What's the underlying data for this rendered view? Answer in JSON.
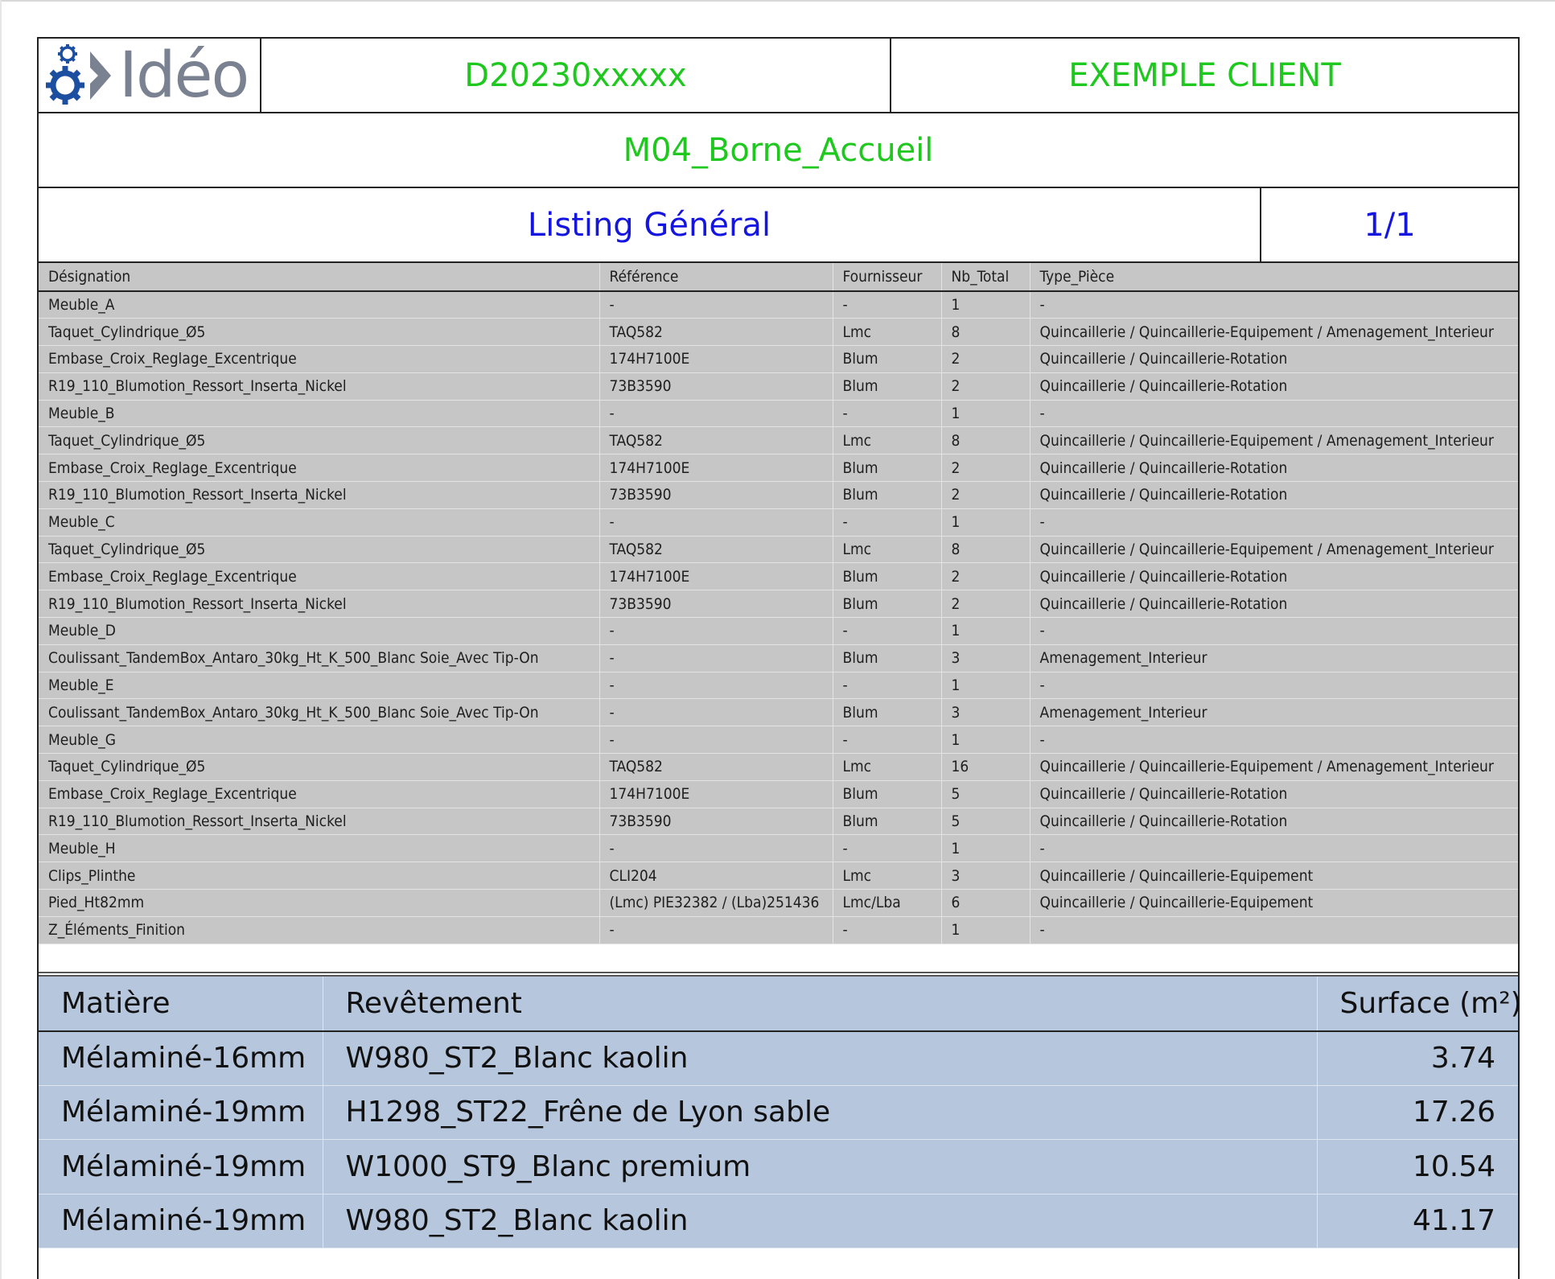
{
  "header": {
    "logo_text": "Idéo",
    "project_code": "D20230xxxxx",
    "client": "EXEMPLE CLIENT",
    "module": "M04_Borne_Accueil",
    "listing_title": "Listing Général",
    "page": "1/1"
  },
  "colors": {
    "green_text": "#1ec81e",
    "blue_text": "#1515e0",
    "table_gray": "#c6c6c6",
    "material_blue": "#b6c6dc",
    "logo_blue": "#1c4fa0"
  },
  "listing": {
    "columns": [
      "Désignation",
      "Référence",
      "Fournisseur",
      "Nb_Total",
      "Type_Pièce"
    ],
    "rows": [
      {
        "d": "Meuble_A",
        "r": "-",
        "f": "-",
        "n": "1",
        "t": "-",
        "indent": false
      },
      {
        "d": "Taquet_Cylindrique_Ø5",
        "r": "TAQ582",
        "f": "Lmc",
        "n": "8",
        "t": "Quincaillerie / Quincaillerie-Equipement / Amenagement_Interieur",
        "indent": true
      },
      {
        "d": "Embase_Croix_Reglage_Excentrique",
        "r": "174H7100E",
        "f": "Blum",
        "n": "2",
        "t": "Quincaillerie / Quincaillerie-Rotation",
        "indent": true
      },
      {
        "d": "R19_110_Blumotion_Ressort_Inserta_Nickel",
        "r": "73B3590",
        "f": "Blum",
        "n": "2",
        "t": "Quincaillerie / Quincaillerie-Rotation",
        "indent": true
      },
      {
        "d": "Meuble_B",
        "r": "-",
        "f": "-",
        "n": "1",
        "t": "-",
        "indent": false
      },
      {
        "d": "Taquet_Cylindrique_Ø5",
        "r": "TAQ582",
        "f": "Lmc",
        "n": "8",
        "t": "Quincaillerie / Quincaillerie-Equipement / Amenagement_Interieur",
        "indent": true
      },
      {
        "d": "Embase_Croix_Reglage_Excentrique",
        "r": "174H7100E",
        "f": "Blum",
        "n": "2",
        "t": "Quincaillerie / Quincaillerie-Rotation",
        "indent": true
      },
      {
        "d": "R19_110_Blumotion_Ressort_Inserta_Nickel",
        "r": "73B3590",
        "f": "Blum",
        "n": "2",
        "t": "Quincaillerie / Quincaillerie-Rotation",
        "indent": true
      },
      {
        "d": "Meuble_C",
        "r": "-",
        "f": "-",
        "n": "1",
        "t": "-",
        "indent": false
      },
      {
        "d": "Taquet_Cylindrique_Ø5",
        "r": "TAQ582",
        "f": "Lmc",
        "n": "8",
        "t": "Quincaillerie / Quincaillerie-Equipement / Amenagement_Interieur",
        "indent": true
      },
      {
        "d": "Embase_Croix_Reglage_Excentrique",
        "r": "174H7100E",
        "f": "Blum",
        "n": "2",
        "t": "Quincaillerie / Quincaillerie-Rotation",
        "indent": true
      },
      {
        "d": "R19_110_Blumotion_Ressort_Inserta_Nickel",
        "r": "73B3590",
        "f": "Blum",
        "n": "2",
        "t": "Quincaillerie / Quincaillerie-Rotation",
        "indent": true
      },
      {
        "d": "Meuble_D",
        "r": "-",
        "f": "-",
        "n": "1",
        "t": "-",
        "indent": false
      },
      {
        "d": "Coulissant_TandemBox_Antaro_30kg_Ht_K_500_Blanc Soie_Avec Tip-On",
        "r": "-",
        "f": "Blum",
        "n": "3",
        "t": "Amenagement_Interieur",
        "indent": true
      },
      {
        "d": "Meuble_E",
        "r": "-",
        "f": "-",
        "n": "1",
        "t": "-",
        "indent": false
      },
      {
        "d": "Coulissant_TandemBox_Antaro_30kg_Ht_K_500_Blanc Soie_Avec Tip-On",
        "r": "-",
        "f": "Blum",
        "n": "3",
        "t": "Amenagement_Interieur",
        "indent": true
      },
      {
        "d": "Meuble_G",
        "r": "-",
        "f": "-",
        "n": "1",
        "t": "-",
        "indent": false
      },
      {
        "d": "Taquet_Cylindrique_Ø5",
        "r": "TAQ582",
        "f": "Lmc",
        "n": "16",
        "t": "Quincaillerie / Quincaillerie-Equipement / Amenagement_Interieur",
        "indent": true
      },
      {
        "d": "Embase_Croix_Reglage_Excentrique",
        "r": "174H7100E",
        "f": "Blum",
        "n": "5",
        "t": "Quincaillerie / Quincaillerie-Rotation",
        "indent": true
      },
      {
        "d": "R19_110_Blumotion_Ressort_Inserta_Nickel",
        "r": "73B3590",
        "f": "Blum",
        "n": "5",
        "t": "Quincaillerie / Quincaillerie-Rotation",
        "indent": true
      },
      {
        "d": "Meuble_H",
        "r": "-",
        "f": "-",
        "n": "1",
        "t": "-",
        "indent": false
      },
      {
        "d": "Clips_Plinthe",
        "r": "CLI204",
        "f": "Lmc",
        "n": "3",
        "t": "Quincaillerie / Quincaillerie-Equipement",
        "indent": true
      },
      {
        "d": "Pied_Ht82mm",
        "r": "(Lmc) PIE32382 / (Lba)251436",
        "f": "Lmc/Lba",
        "n": "6",
        "t": "Quincaillerie / Quincaillerie-Equipement",
        "indent": true
      },
      {
        "d": "Z_Éléments_Finition",
        "r": "-",
        "f": "-",
        "n": "1",
        "t": "-",
        "indent": false
      }
    ]
  },
  "materials": {
    "columns": [
      "Matière",
      "Revêtement",
      "Surface (m²)"
    ],
    "rows": [
      {
        "matiere": "Mélaminé-16mm",
        "revetement": "W980_ST2_Blanc kaolin",
        "surface": "3.74"
      },
      {
        "matiere": "Mélaminé-19mm",
        "revetement": "H1298_ST22_Frêne de Lyon sable",
        "surface": "17.26"
      },
      {
        "matiere": "Mélaminé-19mm",
        "revetement": "W1000_ST9_Blanc premium",
        "surface": "10.54"
      },
      {
        "matiere": "Mélaminé-19mm",
        "revetement": "W980_ST2_Blanc kaolin",
        "surface": "41.17"
      }
    ]
  }
}
